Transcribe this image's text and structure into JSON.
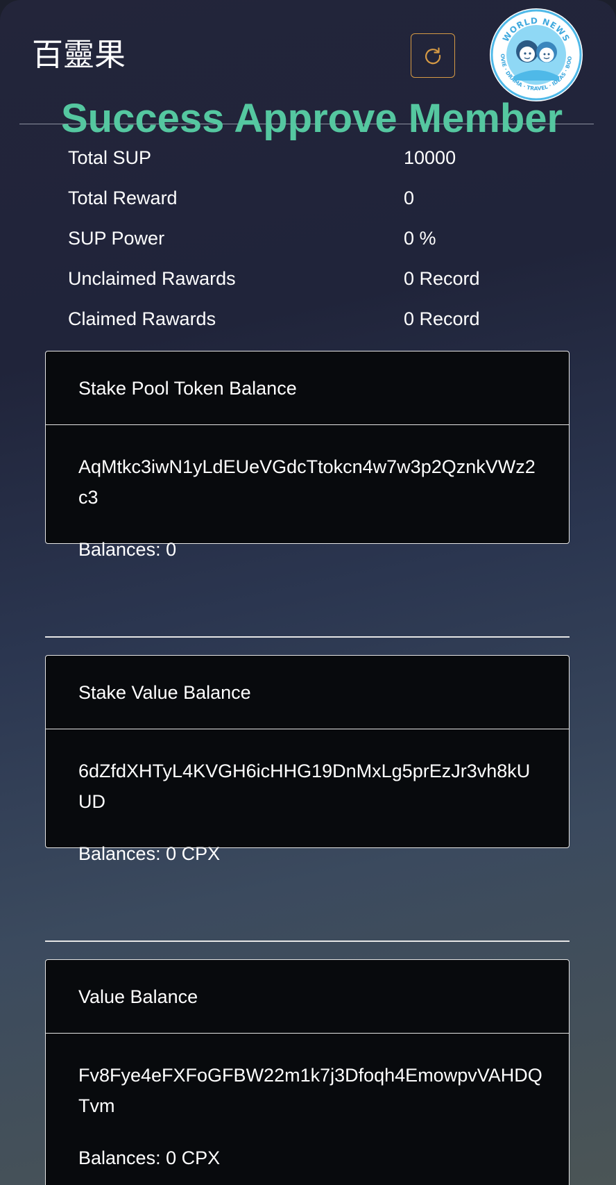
{
  "header": {
    "app_title": "百靈果",
    "refresh_icon": "refresh-icon",
    "logo": {
      "icon": "world-news-logo",
      "text_top": "WORLD NEWS",
      "text_bottom": "MOVIE · DRAMA · TRAVEL · IDEAS · BOOKS"
    }
  },
  "banner": {
    "text": "Success Approve Member",
    "color": "#55c7a0"
  },
  "stats": [
    {
      "label": "Total SUP",
      "value": "10000"
    },
    {
      "label": "Total Reward",
      "value": "0"
    },
    {
      "label": "SUP Power",
      "value": "0 %"
    },
    {
      "label": "Unclaimed Rawards",
      "value": "0 Record"
    },
    {
      "label": "Claimed Rawards",
      "value": "0 Record"
    }
  ],
  "cards": [
    {
      "title": "Stake Pool Token Balance",
      "address": "AqMtkc3iwN1yLdEUeVGdcTtokcn4w7w3p2QznkVWz2c3",
      "balance": "Balances: 0"
    },
    {
      "title": "Stake Value Balance",
      "address": "6dZfdXHTyL4KVGH6icHHG19DnMxLg5prEzJr3vh8kUUD",
      "balance": "Balances: 0 CPX"
    },
    {
      "title": "Value Balance",
      "address": "Fv8Fye4eFXFoGFBW22m1k7j3Dfoqh4EmowpvVAHDQTvm",
      "balance": "Balances: 0 CPX"
    }
  ],
  "colors": {
    "accent_refresh": "#d69a45",
    "card_bg": "#080a0d",
    "card_border": "#e6e6e6"
  }
}
